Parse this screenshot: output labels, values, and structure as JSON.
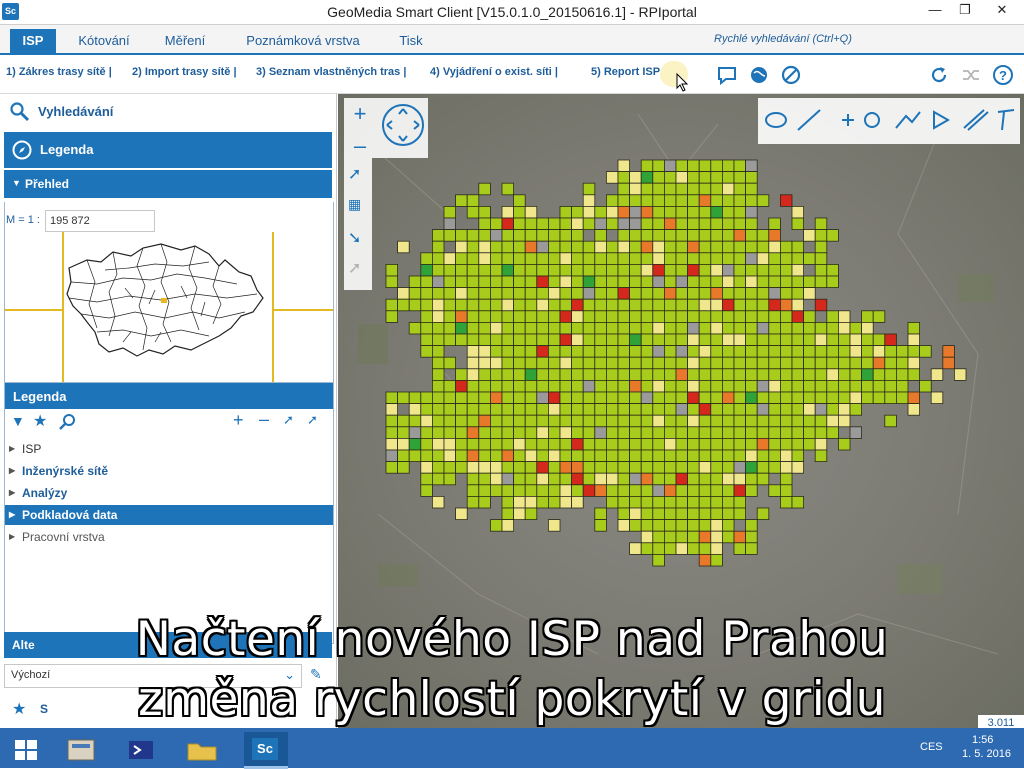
{
  "window": {
    "app_icon": "Sc",
    "title": "GeoMedia Smart Client  [V15.0.1.0_20150616.1] - RPIportal",
    "buttons": [
      "minimize",
      "maximize",
      "close"
    ]
  },
  "ribbon": {
    "tabs": [
      "ISP",
      "Kótování",
      "Měření",
      "Poznámková vrstva",
      "Tisk"
    ],
    "active_tab": "ISP",
    "quick_search_placeholder": "Rychlé vyhledávání (Ctrl+Q)"
  },
  "toolbar": {
    "steps": [
      "1) Zákres trasy sítě |",
      "2) Import trasy sítě |",
      "3) Seznam vlastněných tras |",
      "4) Vyjádření o exist. síti |",
      "5) Report ISP"
    ],
    "right_icons": [
      "comment-icon",
      "globe-icon",
      "no-entry-icon",
      "refresh-icon",
      "shuffle-icon",
      "help-icon"
    ]
  },
  "left_panel": {
    "search_label": "Vyhledávání",
    "legend_header": "Legenda",
    "overview_header": "Přehled",
    "scale_label": "M = 1 :",
    "scale_value": "195 872",
    "legend_section_title": "Legenda",
    "legend_items": [
      {
        "label": "ISP",
        "bold": false,
        "selected": false
      },
      {
        "label": "Inženýrské sítě",
        "bold": true,
        "selected": false
      },
      {
        "label": "Analýzy",
        "bold": true,
        "selected": false
      },
      {
        "label": "Podkladová data",
        "bold": true,
        "selected": true
      },
      {
        "label": "Pracovní vrstva",
        "bold": false,
        "selected": false
      }
    ],
    "alt_header": "Alte",
    "alt_value": "Výchozí",
    "bottom_label": "S"
  },
  "map": {
    "scale_chip": "3.011",
    "colors": {
      "lime": "#a8cc1c",
      "yellow": "#f0e68c",
      "orange": "#e8792b",
      "red": "#d4281c",
      "green": "#2fa337",
      "gray": "#9a9a9a",
      "grid_line": "#2a2a1a"
    }
  },
  "subtitle": {
    "line1": "Načtení nového ISP nad Prahou",
    "line2": "změna rychlostí pokrytí v gridu"
  },
  "taskbar": {
    "clock_time": "1:56",
    "clock_date": "1. 5. 2016",
    "language": "CES"
  }
}
